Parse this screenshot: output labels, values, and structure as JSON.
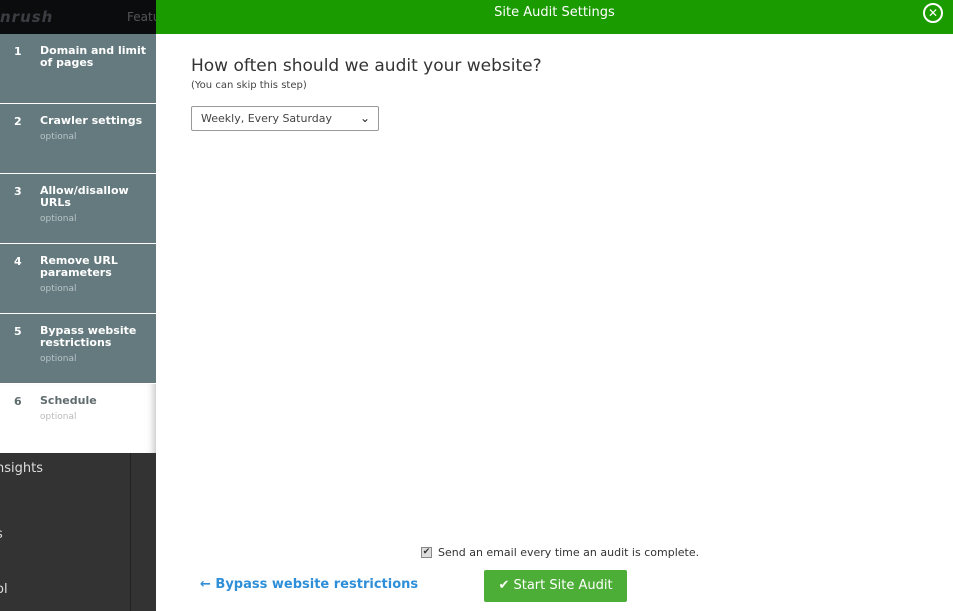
{
  "background": {
    "logo": "nrush",
    "nav_partial": "Featu",
    "side_items": [
      "nsights",
      "s",
      "ol"
    ]
  },
  "steps": [
    {
      "num": "1",
      "title": "Domain and limit of pages",
      "optional": ""
    },
    {
      "num": "2",
      "title": "Crawler settings",
      "optional": "optional"
    },
    {
      "num": "3",
      "title": "Allow/disallow URLs",
      "optional": "optional"
    },
    {
      "num": "4",
      "title": "Remove URL parameters",
      "optional": "optional"
    },
    {
      "num": "5",
      "title": "Bypass website restrictions",
      "optional": "optional"
    },
    {
      "num": "6",
      "title": "Schedule",
      "optional": "optional",
      "active": true
    }
  ],
  "modal": {
    "title": "Site Audit Settings",
    "close_icon": "close-circle-icon",
    "question": "How often should we audit your website?",
    "hint": "(You can skip this step)",
    "schedule_value": "Weekly, Every Saturday",
    "email_label": "Send an email every time an audit is complete.",
    "email_checked": true,
    "back_label": "Bypass website restrictions",
    "start_label": "Start Site Audit",
    "colors": {
      "header": "#1a9b00",
      "start": "#4cae36",
      "link": "#2e8fd8",
      "step_bg": "#647a7e"
    }
  }
}
